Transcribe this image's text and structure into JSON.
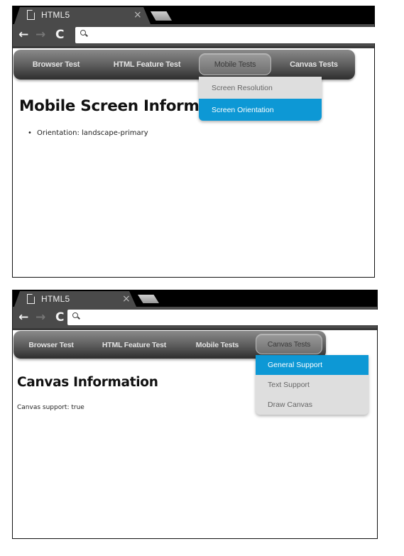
{
  "colors": {
    "tabstrip": "#000000",
    "toolbar": "#4a4a4a",
    "dropdown_bg": "#dedede",
    "dropdown_selected": "#0d98d5"
  },
  "windows": [
    {
      "tab": {
        "icon": "page-icon",
        "title": "HTML5",
        "close_label": "×"
      },
      "toolbar": {
        "back_icon": "←",
        "forward_icon": "→",
        "reload_icon": "C",
        "address_value": "",
        "search_icon": "search-icon"
      },
      "navbar": {
        "items": [
          {
            "label": "Browser Test"
          },
          {
            "label": "HTML Feature Test"
          },
          {
            "label": "Mobile Tests",
            "active": true
          },
          {
            "label": "Canvas Tests"
          }
        ],
        "dropdown": [
          {
            "label": "Screen Resolution"
          },
          {
            "label": "Screen Orientation",
            "selected": true
          }
        ]
      },
      "content": {
        "heading": "Mobile Screen Information",
        "list": [
          "Orientation: landscape-primary"
        ]
      }
    },
    {
      "tab": {
        "icon": "page-icon",
        "title": "HTML5",
        "close_label": "×"
      },
      "toolbar": {
        "back_icon": "←",
        "forward_icon": "→",
        "reload_icon": "C",
        "address_value": "",
        "search_icon": "search-icon"
      },
      "navbar": {
        "items": [
          {
            "label": "Browser Test"
          },
          {
            "label": "HTML Feature Test"
          },
          {
            "label": "Mobile Tests"
          },
          {
            "label": "Canvas Tests",
            "active": true
          }
        ],
        "dropdown": [
          {
            "label": "General Support",
            "selected": true
          },
          {
            "label": "Text Support"
          },
          {
            "label": "Draw Canvas"
          }
        ]
      },
      "content": {
        "heading": "Canvas Information",
        "line": "Canvas support: true"
      }
    }
  ]
}
